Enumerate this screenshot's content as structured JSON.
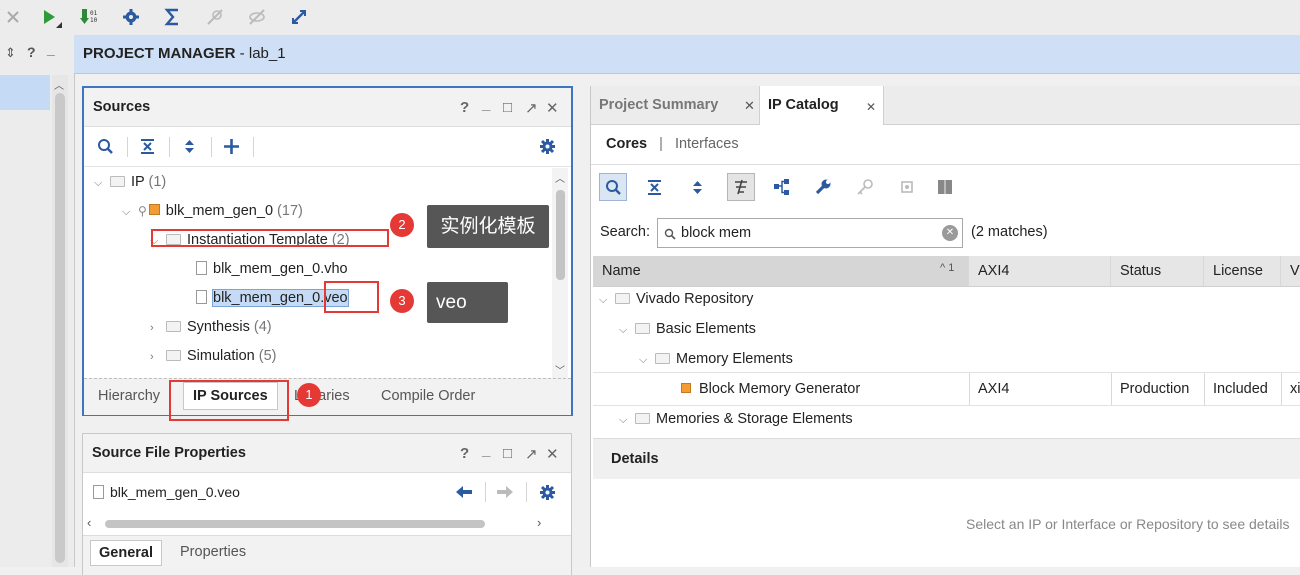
{
  "project_header": {
    "title": "PROJECT MANAGER",
    "separator": " - ",
    "project": "lab_1"
  },
  "left_strip": {
    "sort_glyph": "⇕",
    "help": "?",
    "min": "_"
  },
  "sources_panel": {
    "title": "Sources",
    "controls": [
      "?",
      "_",
      "□",
      "↗",
      "✕"
    ],
    "tree": [
      {
        "label": "IP",
        "count": "(1)"
      },
      {
        "label": "blk_mem_gen_0",
        "count": "(17)"
      },
      {
        "label": "Instantiation Template",
        "count": "(2)"
      },
      {
        "label": "blk_mem_gen_0.vho",
        "count": ""
      },
      {
        "label_prefix": "blk_mem_gen_0",
        "label_selected": ".veo"
      },
      {
        "label": "Synthesis",
        "count": "(4)"
      },
      {
        "label": "Simulation",
        "count": "(5)"
      }
    ],
    "tabs": [
      "Hierarchy",
      "IP Sources",
      "Libraries",
      "Compile Order"
    ],
    "active_tab": "IP Sources"
  },
  "annotations": {
    "callout_1": {
      "badge": "1"
    },
    "callout_2": {
      "badge": "2",
      "text": "实例化模板"
    },
    "callout_3": {
      "badge": "3",
      "text": "veo"
    }
  },
  "source_file_properties": {
    "title": "Source File Properties",
    "controls": [
      "?",
      "_",
      "□",
      "↗",
      "✕"
    ],
    "file": "blk_mem_gen_0.veo",
    "tabs": [
      "General",
      "Properties"
    ],
    "active_tab": "General"
  },
  "ip_catalog": {
    "doc_tabs": [
      "Project Summary",
      "IP Catalog"
    ],
    "active_doc_tab": "IP Catalog",
    "subtabs": [
      "Cores",
      "Interfaces"
    ],
    "subtab_separator": "|",
    "active_subtab": "Cores",
    "search_label": "Search:",
    "search_value": "block mem",
    "match_count": "(2 matches)",
    "columns": [
      "Name",
      "AXI4",
      "Status",
      "License",
      "V"
    ],
    "sort_indicator": "^ 1",
    "rows": [
      {
        "name": "Vivado Repository",
        "axi4": "",
        "status": "",
        "license": "",
        "v": ""
      },
      {
        "name": "Basic Elements",
        "axi4": "",
        "status": "",
        "license": "",
        "v": ""
      },
      {
        "name": "Memory Elements",
        "axi4": "",
        "status": "",
        "license": "",
        "v": ""
      },
      {
        "name": "Block Memory Generator",
        "axi4": "AXI4",
        "status": "Production",
        "license": "Included",
        "v": "xi"
      },
      {
        "name": "Memories & Storage Elements",
        "axi4": "",
        "status": "",
        "license": "",
        "v": ""
      }
    ],
    "details_title": "Details",
    "details_hint": "Select an IP or Interface or Repository to see details"
  },
  "colors": {
    "accent_blue": "#3f75c0",
    "annotation_red": "#e53935",
    "callout_bg": "#565656",
    "header_blue": "#cfe0f6",
    "selection": "#c5daf5"
  }
}
